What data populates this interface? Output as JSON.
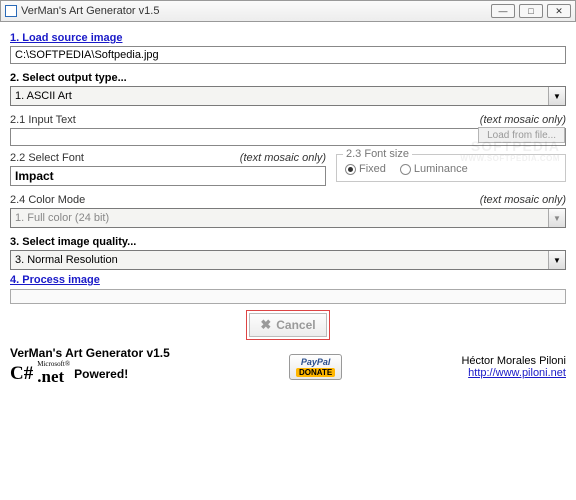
{
  "titlebar": {
    "title": "VerMan's Art Generator v1.5"
  },
  "step1": {
    "heading": "1. Load source image",
    "path": "C:\\SOFTPEDIA\\Softpedia.jpg"
  },
  "step2": {
    "heading": "2. Select output type...",
    "output_type": "1. ASCII Art",
    "input_text": {
      "label": "2.1 Input Text",
      "note": "(text mosaic only)",
      "value": "",
      "load_btn": "Load from file..."
    },
    "font": {
      "label": "2.2 Select Font",
      "note": "(text mosaic only)",
      "value": "Impact"
    },
    "font_size": {
      "legend": "2.3 Font size",
      "fixed": "Fixed",
      "luminance": "Luminance"
    },
    "color_mode": {
      "label": "2.4 Color Mode",
      "note": "(text mosaic only)",
      "value": "1. Full color (24 bit)"
    }
  },
  "step3": {
    "heading": "3. Select image quality...",
    "value": "3. Normal Resolution"
  },
  "step4": {
    "heading": "4. Process image"
  },
  "cancel": {
    "label": "Cancel"
  },
  "footer": {
    "title": "VerMan's Art Generator v1.5",
    "csharp": "C#",
    "ms": "Microsoft®",
    "dotnet": ".net",
    "powered": "Powered!",
    "paypal": "PayPal",
    "donate": "DONATE",
    "author": "Héctor Morales Piloni",
    "url": "http://www.piloni.net"
  },
  "watermark": {
    "main": "SOFTPEDIA",
    "sub": "WWW.SOFTPEDIA.COM"
  }
}
